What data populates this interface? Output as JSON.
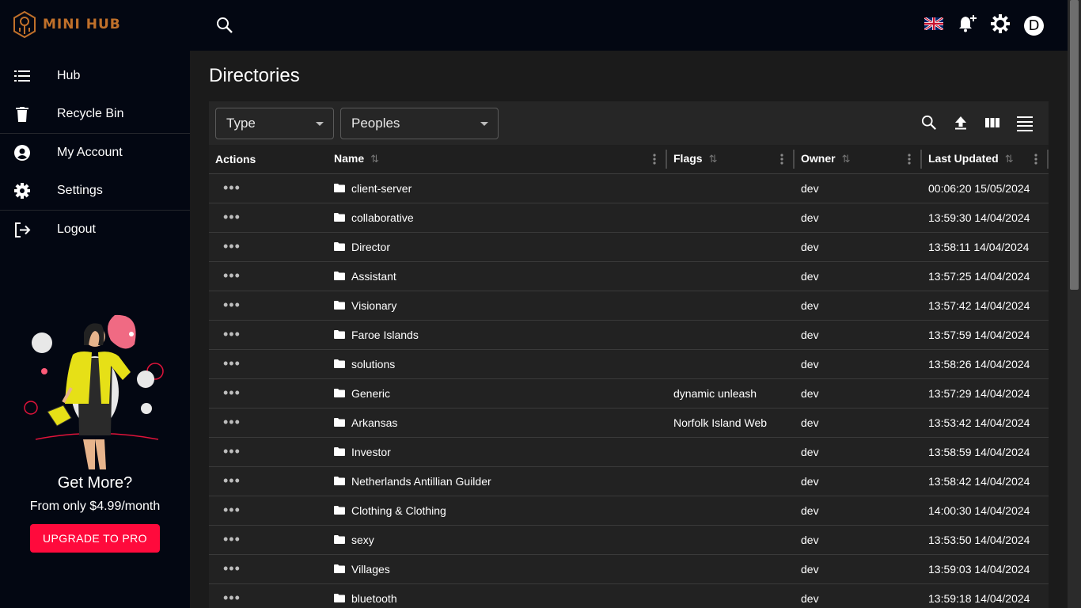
{
  "app": {
    "name": "MINI HUB"
  },
  "sidebar": {
    "items": [
      {
        "label": "Hub",
        "icon": "list-icon"
      },
      {
        "label": "Recycle Bin",
        "icon": "trash-icon"
      },
      {
        "label": "My Account",
        "icon": "account-circle-icon"
      },
      {
        "label": "Settings",
        "icon": "gear-icon"
      },
      {
        "label": "Logout",
        "icon": "logout-icon"
      }
    ],
    "promo": {
      "title": "Get More?",
      "subtitle": "From only $4.99/month",
      "button": "UPGRADE TO PRO"
    }
  },
  "header": {
    "avatar_letter": "D"
  },
  "page": {
    "title": "Directories"
  },
  "filters": {
    "type_label": "Type",
    "peoples_label": "Peoples"
  },
  "table": {
    "columns": {
      "actions": "Actions",
      "name": "Name",
      "flags": "Flags",
      "owner": "Owner",
      "last_updated": "Last Updated"
    },
    "rows": [
      {
        "name": "client-server",
        "flags": "",
        "owner": "dev",
        "updated": "00:06:20 15/05/2024"
      },
      {
        "name": "collaborative",
        "flags": "",
        "owner": "dev",
        "updated": "13:59:30 14/04/2024"
      },
      {
        "name": "Director",
        "flags": "",
        "owner": "dev",
        "updated": "13:58:11 14/04/2024"
      },
      {
        "name": "Assistant",
        "flags": "",
        "owner": "dev",
        "updated": "13:57:25 14/04/2024"
      },
      {
        "name": "Visionary",
        "flags": "",
        "owner": "dev",
        "updated": "13:57:42 14/04/2024"
      },
      {
        "name": "Faroe Islands",
        "flags": "",
        "owner": "dev",
        "updated": "13:57:59 14/04/2024"
      },
      {
        "name": "solutions",
        "flags": "",
        "owner": "dev",
        "updated": "13:58:26 14/04/2024"
      },
      {
        "name": "Generic",
        "flags": "dynamic unleash",
        "owner": "dev",
        "updated": "13:57:29 14/04/2024"
      },
      {
        "name": "Arkansas",
        "flags": "Norfolk Island Web",
        "owner": "dev",
        "updated": "13:53:42 14/04/2024"
      },
      {
        "name": "Investor",
        "flags": "",
        "owner": "dev",
        "updated": "13:58:59 14/04/2024"
      },
      {
        "name": "Netherlands Antillian Guilder",
        "flags": "",
        "owner": "dev",
        "updated": "13:58:42 14/04/2024"
      },
      {
        "name": "Clothing & Clothing",
        "flags": "",
        "owner": "dev",
        "updated": "14:00:30 14/04/2024"
      },
      {
        "name": "sexy",
        "flags": "",
        "owner": "dev",
        "updated": "13:53:50 14/04/2024"
      },
      {
        "name": "Villages",
        "flags": "",
        "owner": "dev",
        "updated": "13:59:03 14/04/2024"
      },
      {
        "name": "bluetooth",
        "flags": "",
        "owner": "dev",
        "updated": "13:59:18 14/04/2024"
      }
    ]
  },
  "colors": {
    "accent": "#ff0a3c",
    "brand": "#c0702a",
    "sidebar_bg": "#030712"
  }
}
